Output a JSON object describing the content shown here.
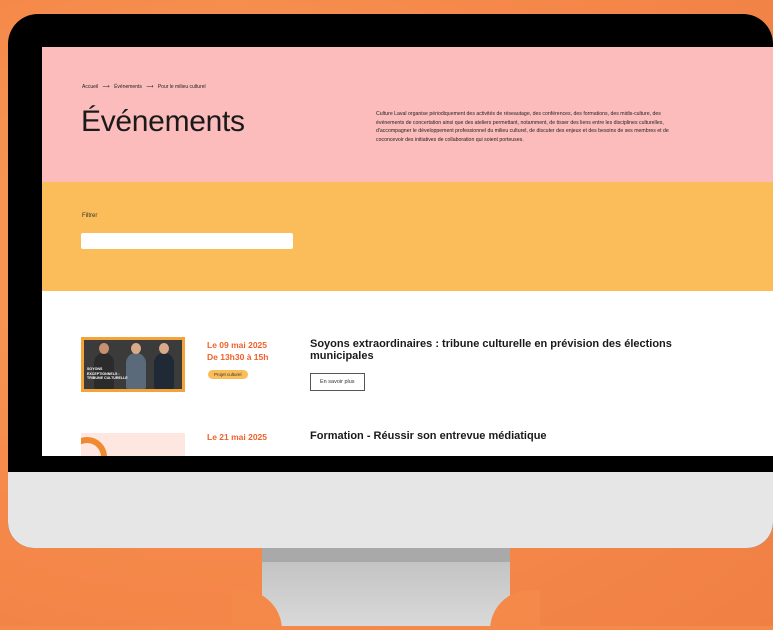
{
  "breadcrumb": {
    "items": [
      "Accueil",
      "Événements",
      "Pour le milieu culturel"
    ],
    "separator": "⟶"
  },
  "hero": {
    "title": "Événements",
    "intro": "Culture Laval organise périodiquement des activités de réseautage, des conférences, des formations, des midis-culture, des événements de concertation ainsi que des ateliers permettant, notamment, de tisser des liens entre les disciplines culturelles, d'accompagner le développement professionnel du milieu culturel, de discuter des enjeux et des besoins de ses membres et de coconcevoir des initiatives de collaboration qui soient porteuses."
  },
  "filter": {
    "label": "Filtrer",
    "value": ""
  },
  "events": [
    {
      "date_line1": "Le 09 mai 2025",
      "date_line2": "De 13h30 à 15h",
      "tag": "Projet culturel",
      "title": "Soyons extraordinaires : tribune culturelle en prévision des élections municipales",
      "button": "En savoir plus",
      "thumb_caption": "SOYONS EXCEPTIONNELS : TRIBUNE CULTURELLE"
    },
    {
      "date_line1": "Le 21 mai 2025",
      "title": "Formation - Réussir son entrevue médiatique"
    }
  ],
  "colors": {
    "background": "#f5894a",
    "hero": "#fdbcbc",
    "filter_band": "#fbbd59",
    "date_accent": "#f0602a",
    "tag": "#fbbd59"
  }
}
